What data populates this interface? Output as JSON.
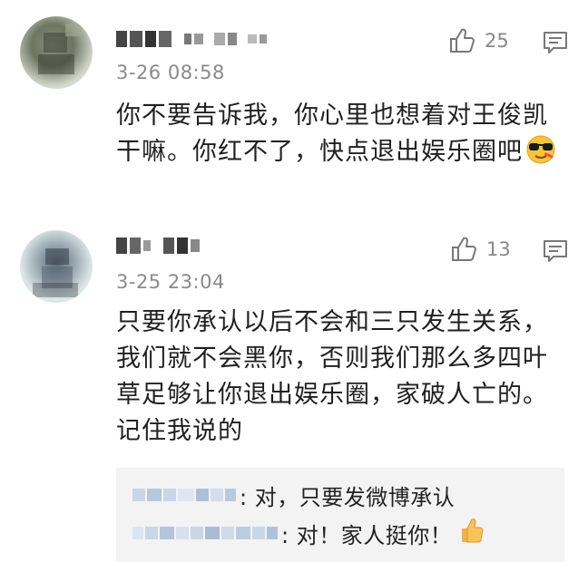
{
  "comments": [
    {
      "time": "3-26 08:58",
      "likes": "25",
      "text": "你不要告诉我，你心里也想着对王俊凯干嘛。你红不了，快点退出娱乐圈吧",
      "emoji": "sunglasses-emoji"
    },
    {
      "time": "3-25 23:04",
      "likes": "13",
      "text": "只要你承认以后不会和三只发生关系，我们就不会黑你，否则我们那么多四叶草足够让你退出娱乐圈，家破人亡的。记住我说的",
      "replies": [
        {
          "text": ": 对，只要发微博承认"
        },
        {
          "text": ": 对！家人挺你！",
          "emoji": "thumbs-up-emoji"
        }
      ]
    }
  ],
  "icons": {
    "like": "thumbs-up-icon",
    "reply": "comment-icon"
  },
  "colors": {
    "meta": "#8a8a8a",
    "reply_bg": "#f3f3f3",
    "text": "#1f1f1f"
  }
}
